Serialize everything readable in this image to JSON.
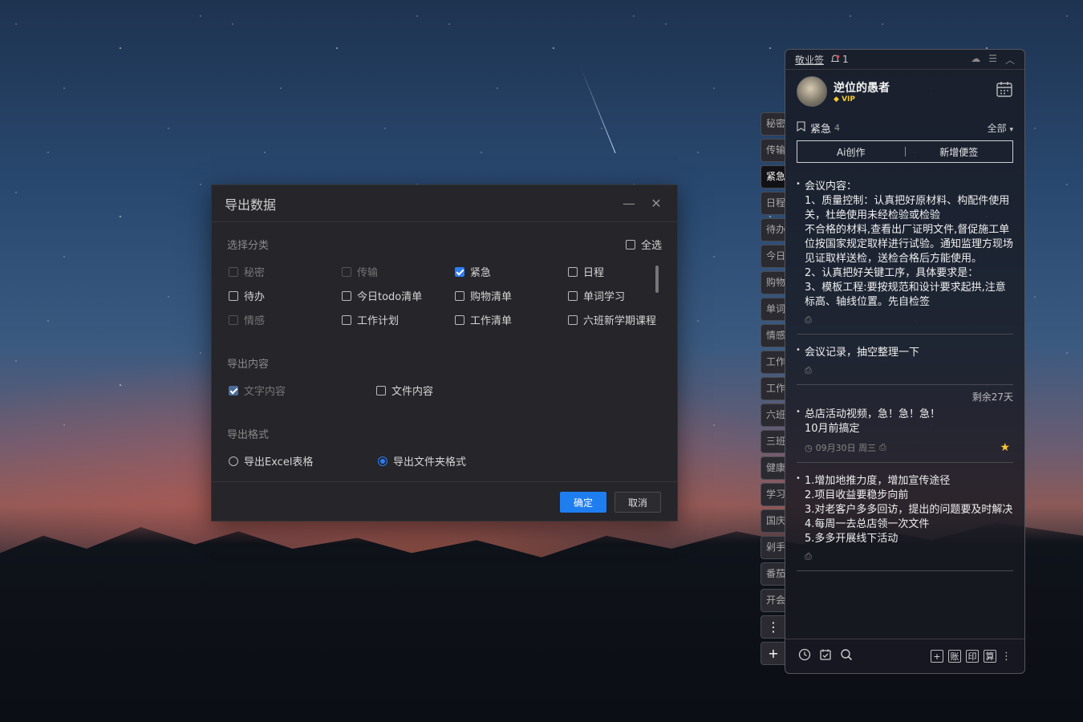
{
  "dialog": {
    "title": "导出数据",
    "section_category": "选择分类",
    "select_all": "全选",
    "categories": [
      {
        "label": "秘密",
        "state": "disabled"
      },
      {
        "label": "传输",
        "state": "disabled"
      },
      {
        "label": "紧急",
        "state": "checked"
      },
      {
        "label": "日程",
        "state": "unchecked"
      },
      {
        "label": "待办",
        "state": "unchecked"
      },
      {
        "label": "今日todo清单",
        "state": "unchecked"
      },
      {
        "label": "购物清单",
        "state": "unchecked"
      },
      {
        "label": "单词学习",
        "state": "unchecked"
      },
      {
        "label": "情感",
        "state": "disabled"
      },
      {
        "label": "工作计划",
        "state": "unchecked"
      },
      {
        "label": "工作清单",
        "state": "unchecked"
      },
      {
        "label": "六班新学期课程",
        "state": "unchecked"
      }
    ],
    "section_content": "导出内容",
    "content_text": "文字内容",
    "content_file": "文件内容",
    "section_format": "导出格式",
    "format_excel": "导出Excel表格",
    "format_folder": "导出文件夹格式",
    "confirm": "确定",
    "cancel": "取消"
  },
  "tabs": [
    "秘密",
    "传输",
    "紧急",
    "日程",
    "待办",
    "今日",
    "购物",
    "单词",
    "情感",
    "工作",
    "工作",
    "六班",
    "三班",
    "健康",
    "学习",
    "国庆",
    "剁手",
    "番茄",
    "开会"
  ],
  "tabs_more": "⋮",
  "tabs_add": "+",
  "panel": {
    "app_name": "敬业签",
    "reminder_count": "1",
    "user_name": "逆位的愚者",
    "vip": "VIP",
    "category": "紧急",
    "category_count": "4",
    "filter": "全部",
    "ai_button": "Ai创作",
    "new_note_button": "新增便签",
    "notes": [
      {
        "text": "会议内容：\n1、质量控制：认真把好原材料、构配件使用关，杜绝使用未经检验或检验\n不合格的材料,查看出厂证明文件,督促施工单位按国家规定取样进行试验。通知监理方现场见证取样送检，送检合格后方能使用。\n2、认真把好关键工序，具体要求是：\n3、模板工程:要按规范和设计要求起拱,注意标高、轴线位置。先自检签"
      },
      {
        "text": "会议记录，抽空整理一下"
      },
      {
        "text": "总店活动视频，急！急！急！\n10月前搞定",
        "remaining": "剩余27天",
        "date": "09月30日 周三"
      },
      {
        "text": "1.增加地推力度，增加宣传途径\n2.项目收益要稳步向前\n3.对老客户多多回访，提出的问题要及时解决\n4.每周一去总店领一次文件\n5.多多开展线下活动"
      }
    ],
    "bottom_right": [
      "+",
      "账",
      "印",
      "算"
    ]
  }
}
